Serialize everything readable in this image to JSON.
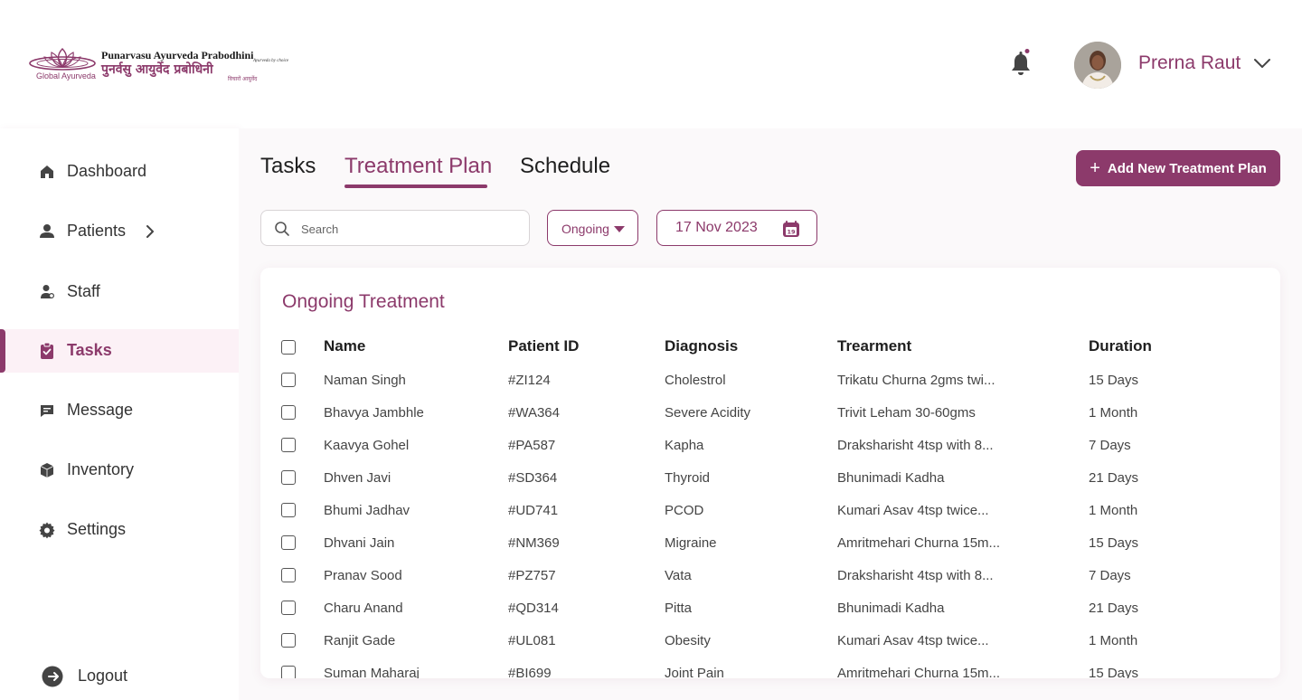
{
  "brand": {
    "name_en": "Punarvasu Ayurveda Prabodhini",
    "tagline": "Ayurveda by choice",
    "name_hi": "पुनर्वसु आयुर्वेद प्रबोधिनी",
    "sub_hi": "विचारों आयुर्वेद",
    "mark_label": "Global Ayurveda"
  },
  "user": {
    "name": "Prerna Raut"
  },
  "sidebar": {
    "items": [
      {
        "label": "Dashboard",
        "icon": "home-icon"
      },
      {
        "label": "Patients",
        "icon": "person-icon"
      },
      {
        "label": "Staff",
        "icon": "staff-icon"
      },
      {
        "label": "Tasks",
        "icon": "clipboard-check-icon"
      },
      {
        "label": "Message",
        "icon": "message-icon"
      },
      {
        "label": "Inventory",
        "icon": "box-icon"
      },
      {
        "label": "Settings",
        "icon": "gear-icon"
      }
    ],
    "active_index": 3,
    "logout_label": "Logout"
  },
  "tabs": [
    {
      "label": "Tasks"
    },
    {
      "label": "Treatment Plan"
    },
    {
      "label": "Schedule"
    }
  ],
  "active_tab": 1,
  "actions": {
    "add_label": "Add New Treatment Plan"
  },
  "filters": {
    "search_placeholder": "Search",
    "status_value": "Ongoing",
    "date_value": "17 Nov 2023",
    "calendar_day": "19"
  },
  "table": {
    "title": "Ongoing Treatment",
    "columns": [
      "Name",
      "Patient ID",
      "Diagnosis",
      "Trearment",
      "Duration"
    ],
    "rows": [
      [
        "Naman Singh",
        "#ZI124",
        "Cholestrol",
        "Trikatu Churna 2gms twi...",
        "15 Days"
      ],
      [
        "Bhavya Jambhle",
        "#WA364",
        "Severe Acidity",
        "Trivit Leham 30-60gms",
        "1 Month"
      ],
      [
        "Kaavya Gohel",
        "#PA587",
        "Kapha",
        "Draksharisht 4tsp with 8...",
        "7 Days"
      ],
      [
        "Dhven Javi",
        "#SD364",
        "Thyroid",
        "Bhunimadi Kadha",
        "21 Days"
      ],
      [
        "Bhumi Jadhav",
        "#UD741",
        "PCOD",
        "Kumari Asav 4tsp twice...",
        "1 Month"
      ],
      [
        "Dhvani Jain",
        "#NM369",
        "Migraine",
        "Amritmehari Churna 15m...",
        "15 Days"
      ],
      [
        "Pranav Sood",
        "#PZ757",
        "Vata",
        "Draksharisht 4tsp with 8...",
        "7 Days"
      ],
      [
        "Charu Anand",
        "#QD314",
        "Pitta",
        "Bhunimadi Kadha",
        "21 Days"
      ],
      [
        "Ranjit Gade",
        "#UL081",
        "Obesity",
        "Kumari Asav 4tsp twice...",
        "1 Month"
      ],
      [
        "Suman Maharaj",
        "#BI699",
        "Joint Pain",
        "Amritmehari Churna 15m...",
        "15 Days"
      ]
    ]
  },
  "colors": {
    "accent": "#8c3a6b",
    "active_bg": "#fcf1f6"
  }
}
